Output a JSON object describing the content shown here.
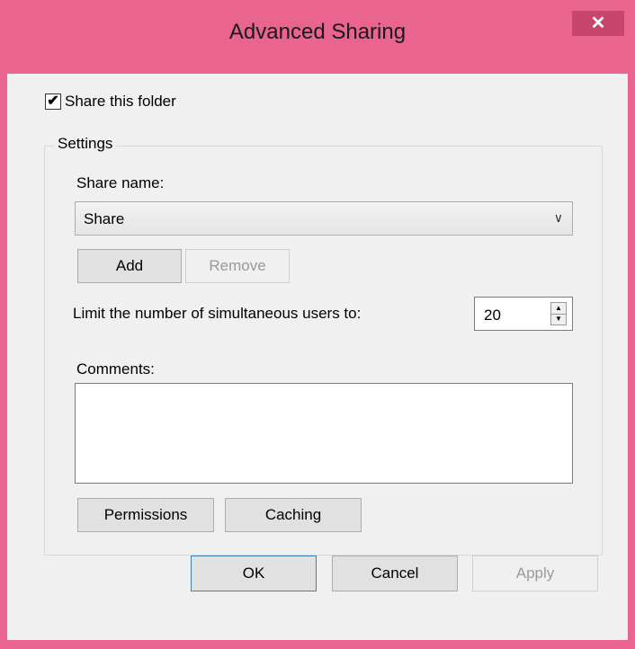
{
  "window": {
    "title": "Advanced Sharing",
    "close_glyph": "✕"
  },
  "share": {
    "checkbox_label": "Share this folder",
    "checked": true,
    "check_glyph": "✔"
  },
  "settings": {
    "legend": "Settings",
    "share_name_label": "Share name:",
    "share_name_value": "Share",
    "dropdown_glyph": "∨",
    "add_label": "Add",
    "remove_label": "Remove",
    "limit_label": "Limit the number of simultaneous users to:",
    "limit_value": "20",
    "comments_label": "Comments:",
    "comments_value": "",
    "permissions_label": "Permissions",
    "caching_label": "Caching"
  },
  "footer": {
    "ok_label": "OK",
    "cancel_label": "Cancel",
    "apply_label": "Apply"
  },
  "colors": {
    "title_bar": "#e9648f",
    "close_button": "#c8466e",
    "client_bg": "#f0f0f0"
  }
}
